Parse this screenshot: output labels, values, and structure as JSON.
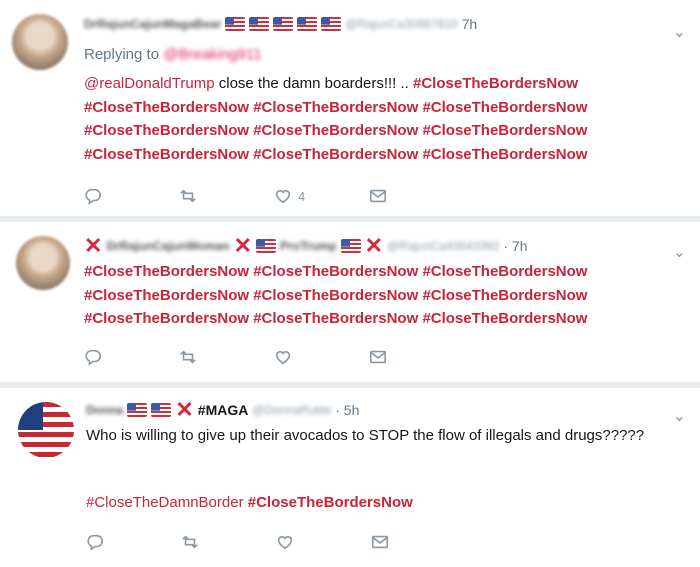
{
  "tweets": [
    {
      "name": "DrRajunCajunMagaBear",
      "handle": "@RajunCa30887810",
      "time": "7h",
      "replying_label": "Replying to",
      "replying_to": "@Breaking911",
      "mention": "@realDonaldTrump",
      "text_after_mention": " close the damn boarders!!! .. ",
      "hashtag": "#CloseTheBordersNow",
      "like_count": "4"
    },
    {
      "name": "DrRajunCajunWoman",
      "name2": "ProTrump",
      "handle": "@RajunCa43643392",
      "time": "· 7h",
      "hashtag": "#CloseTheBordersNow"
    },
    {
      "name": "Donna",
      "maga": "#MAGA",
      "handle": "@DonnaRuble",
      "time": "· 5h",
      "text": "Who is willing to give up their avocados to STOP the flow of illegals and drugs?????",
      "hashtag1": "#CloseTheDamnBorder",
      "hashtag2": "#CloseTheBordersNow"
    }
  ],
  "icons": [
    "reply-icon",
    "retweet-icon",
    "like-icon",
    "message-icon",
    "chevron-down-icon"
  ],
  "colors": {
    "hashtag": "#c6253a",
    "action": "#8899a6",
    "muted": "#657786"
  }
}
